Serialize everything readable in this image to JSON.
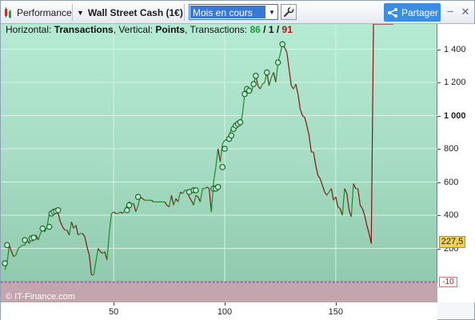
{
  "toolbar": {
    "performance_label": "Performance",
    "instrument_label": "Wall Street Cash (1€)",
    "period_select": "Mois en cours",
    "share_label": "Partager",
    "minimize_glyph": "–",
    "close_glyph": "✕",
    "icons": [
      "chart-icon",
      "wrench-icon",
      "share-icon"
    ]
  },
  "header": {
    "horizontal_prefix": "Horizontal: ",
    "horizontal_value": "Transactions",
    "vertical_prefix": ", Vertical: ",
    "vertical_value": "Points",
    "transactions_prefix": ", Transactions: ",
    "wins": "86",
    "sep1": " / ",
    "neutral": "1",
    "sep2": " / ",
    "losses": "91"
  },
  "footer": {
    "copyright": "© IT-Finance.com"
  },
  "colors": {
    "up_line": "#1e8b24",
    "down_line": "#8a1212",
    "price_badge": "#f2d34a",
    "negative_zone": "#c3a5ae",
    "zero_line": "#6b6ad8"
  },
  "chart_data": {
    "type": "line",
    "x_ticks": [
      50,
      100,
      150
    ],
    "y_ticks": [
      {
        "value": 200,
        "label": "200"
      },
      {
        "value": 400,
        "label": "400"
      },
      {
        "value": 600,
        "label": "600"
      },
      {
        "value": 800,
        "label": "800"
      },
      {
        "value": 1000,
        "label": "1 000"
      },
      {
        "value": 1200,
        "label": "1 200"
      },
      {
        "value": 1400,
        "label": "1 400"
      }
    ],
    "xlim": [
      0,
      196
    ],
    "ylim": [
      -10,
      1555
    ],
    "current_value_label": "227,5",
    "negative_label": "-10",
    "x": [
      1,
      2,
      3,
      4,
      5,
      6,
      7,
      8,
      9,
      10,
      11,
      12,
      13,
      14,
      15,
      16,
      17,
      18,
      19,
      20,
      21,
      22,
      23,
      24,
      25,
      26,
      27,
      28,
      29,
      30,
      31,
      32,
      33,
      34,
      35,
      36,
      37,
      38,
      39,
      40,
      41,
      42,
      43,
      44,
      45,
      46,
      47,
      48,
      49,
      50,
      51,
      52,
      53,
      54,
      55,
      56,
      57,
      58,
      59,
      60,
      61,
      62,
      63,
      64,
      65,
      66,
      67,
      68,
      69,
      70,
      71,
      72,
      73,
      74,
      75,
      76,
      77,
      78,
      79,
      80,
      81,
      82,
      83,
      84,
      85,
      86,
      87,
      88,
      89,
      90,
      91,
      92,
      93,
      94,
      95,
      96,
      97,
      98,
      99,
      100,
      101,
      102,
      103,
      104,
      105,
      106,
      107,
      108,
      109,
      110,
      111,
      112,
      113,
      114,
      115,
      116,
      117,
      118,
      119,
      120,
      121,
      122,
      123,
      124,
      125,
      126,
      127,
      128,
      129,
      130,
      131,
      132,
      133,
      134,
      135,
      136,
      137,
      138,
      139,
      140,
      141,
      142,
      143,
      144,
      145,
      146,
      147,
      148,
      149,
      150,
      151,
      152,
      153,
      154,
      155,
      156,
      157,
      158,
      159,
      160,
      161,
      162,
      163,
      164,
      165,
      166,
      167,
      168,
      169,
      170,
      171,
      172,
      173,
      174,
      175,
      176
    ],
    "y": [
      70,
      110,
      220,
      180,
      150,
      160,
      200,
      210,
      220,
      220,
      250,
      230,
      260,
      265,
      280,
      250,
      290,
      320,
      300,
      330,
      410,
      420,
      425,
      430,
      410,
      360,
      330,
      310,
      310,
      280,
      360,
      320,
      340,
      280,
      290,
      290,
      270,
      210,
      160,
      40,
      40,
      120,
      200,
      180,
      170,
      180,
      130,
      290,
      410,
      420,
      410,
      410,
      420,
      410,
      430,
      460,
      480,
      470,
      470,
      420,
      460,
      510,
      500,
      490,
      490,
      490,
      490,
      480,
      480,
      480,
      480,
      480,
      480,
      460,
      450,
      520,
      460,
      500,
      480,
      540,
      530,
      550,
      550,
      510,
      490,
      460,
      520,
      510,
      480,
      560,
      560,
      570,
      560,
      420,
      600,
      690,
      800,
      720,
      830,
      850,
      860,
      880,
      920,
      940,
      950,
      960,
      940,
      1010,
      1130,
      1160,
      1150,
      1140,
      1190,
      1240,
      1180,
      1160,
      1190,
      1200,
      1260,
      1180,
      1230,
      1260,
      1200,
      1320,
      1370,
      1430,
      1410,
      1380,
      1280,
      1180,
      1160,
      1190,
      1130,
      1040,
      1000,
      990,
      940,
      880,
      780,
      780,
      700,
      640,
      620,
      580,
      540,
      520,
      540,
      560,
      490,
      510,
      450,
      440,
      400,
      560,
      530,
      430,
      390,
      590,
      560,
      560,
      460,
      440,
      400,
      340,
      290,
      230
    ],
    "markers": [
      [
        1,
        110
      ],
      [
        2,
        220
      ],
      [
        10,
        250
      ],
      [
        13,
        260
      ],
      [
        14,
        265
      ],
      [
        18,
        320
      ],
      [
        21,
        330
      ],
      [
        22,
        410
      ],
      [
        23,
        420
      ],
      [
        24,
        425
      ],
      [
        25,
        430
      ],
      [
        56,
        430
      ],
      [
        57,
        460
      ],
      [
        61,
        510
      ],
      [
        84,
        540
      ],
      [
        86,
        550
      ],
      [
        87,
        550
      ],
      [
        95,
        560
      ],
      [
        96,
        560
      ],
      [
        97,
        570
      ],
      [
        99,
        690
      ],
      [
        100,
        800
      ],
      [
        102,
        860
      ],
      [
        103,
        880
      ],
      [
        104,
        920
      ],
      [
        105,
        940
      ],
      [
        106,
        950
      ],
      [
        107,
        960
      ],
      [
        109,
        1130
      ],
      [
        110,
        1160
      ],
      [
        111,
        1150
      ],
      [
        113,
        1190
      ],
      [
        114,
        1240
      ],
      [
        119,
        1260
      ],
      [
        124,
        1320
      ],
      [
        126,
        1430
      ]
    ]
  }
}
